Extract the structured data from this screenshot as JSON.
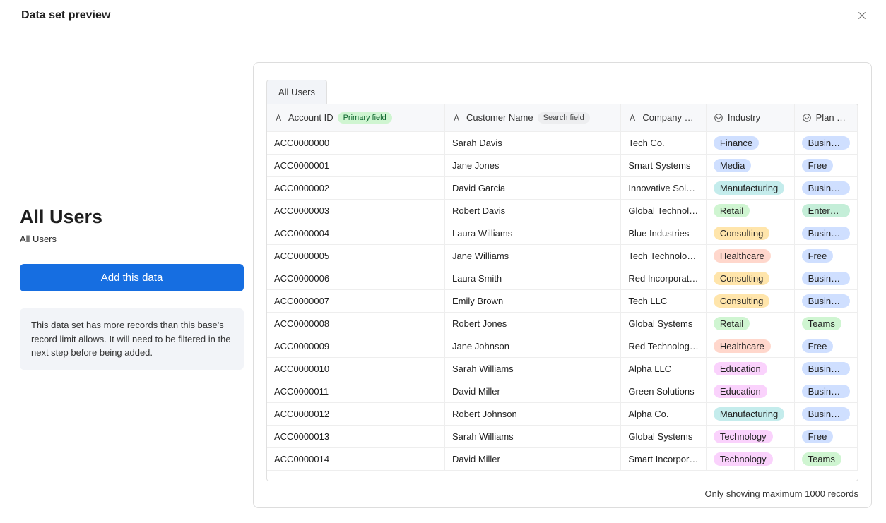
{
  "header": {
    "title": "Data set preview"
  },
  "sidebar": {
    "title": "All Users",
    "subtitle": "All Users",
    "add_label": "Add this data",
    "info": "This data set has more records than this base's record limit allows. It will need to be filtered in the next step before being added."
  },
  "tabs": [
    {
      "label": "All Users"
    }
  ],
  "columns": {
    "account": {
      "label": "Account ID",
      "badge": "Primary field",
      "icon": "text"
    },
    "customer": {
      "label": "Customer Name",
      "badge": "Search field",
      "icon": "text"
    },
    "company": {
      "label": "Company Nam",
      "icon": "text"
    },
    "industry": {
      "label": "Industry",
      "icon": "select"
    },
    "plan": {
      "label": "Plan Tier",
      "icon": "select"
    }
  },
  "industry_palette": {
    "Finance": "blue",
    "Media": "blue",
    "Manufacturing": "teal",
    "Retail": "green",
    "Consulting": "yellow",
    "Healthcare": "salmon",
    "Education": "pink",
    "Technology": "pink"
  },
  "plan_palette": {
    "Business": "blue",
    "Free": "blue",
    "Enterprise": "mint",
    "Teams": "green"
  },
  "rows": [
    {
      "account": "ACC0000000",
      "customer": "Sarah Davis",
      "company": "Tech Co.",
      "industry": "Finance",
      "plan": "Business"
    },
    {
      "account": "ACC0000001",
      "customer": "Jane Jones",
      "company": "Smart Systems",
      "industry": "Media",
      "plan": "Free"
    },
    {
      "account": "ACC0000002",
      "customer": "David Garcia",
      "company": "Innovative Solu…",
      "industry": "Manufacturing",
      "plan": "Business"
    },
    {
      "account": "ACC0000003",
      "customer": "Robert Davis",
      "company": "Global Technol…",
      "industry": "Retail",
      "plan": "Enterprise"
    },
    {
      "account": "ACC0000004",
      "customer": "Laura Williams",
      "company": "Blue Industries",
      "industry": "Consulting",
      "plan": "Business"
    },
    {
      "account": "ACC0000005",
      "customer": "Jane Williams",
      "company": "Tech Technolo…",
      "industry": "Healthcare",
      "plan": "Free"
    },
    {
      "account": "ACC0000006",
      "customer": "Laura Smith",
      "company": "Red Incorporat…",
      "industry": "Consulting",
      "plan": "Business"
    },
    {
      "account": "ACC0000007",
      "customer": "Emily Brown",
      "company": "Tech LLC",
      "industry": "Consulting",
      "plan": "Business"
    },
    {
      "account": "ACC0000008",
      "customer": "Robert Jones",
      "company": "Global Systems",
      "industry": "Retail",
      "plan": "Teams"
    },
    {
      "account": "ACC0000009",
      "customer": "Jane Johnson",
      "company": "Red Technolog…",
      "industry": "Healthcare",
      "plan": "Free"
    },
    {
      "account": "ACC0000010",
      "customer": "Sarah Williams",
      "company": "Alpha LLC",
      "industry": "Education",
      "plan": "Business"
    },
    {
      "account": "ACC0000011",
      "customer": "David Miller",
      "company": "Green Solutions",
      "industry": "Education",
      "plan": "Business"
    },
    {
      "account": "ACC0000012",
      "customer": "Robert Johnson",
      "company": "Alpha Co.",
      "industry": "Manufacturing",
      "plan": "Business"
    },
    {
      "account": "ACC0000013",
      "customer": "Sarah Williams",
      "company": "Global Systems",
      "industry": "Technology",
      "plan": "Free"
    },
    {
      "account": "ACC0000014",
      "customer": "David Miller",
      "company": "Smart Incorpor…",
      "industry": "Technology",
      "plan": "Teams"
    }
  ],
  "footer": {
    "note": "Only showing maximum 1000 records"
  }
}
